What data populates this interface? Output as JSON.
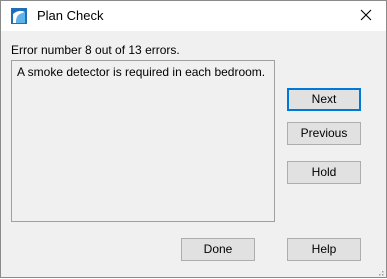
{
  "window": {
    "title": "Plan Check",
    "close_glyph": "✕",
    "app_icon": "plan-check-app-icon",
    "accent_color": "#0078d7"
  },
  "status": {
    "error_count_text": "Error number 8 out of 13 errors."
  },
  "message": {
    "text": "A smoke detector is required in each bedroom."
  },
  "buttons": {
    "next": "Next",
    "previous": "Previous",
    "hold": "Hold",
    "done": "Done",
    "help": "Help"
  }
}
